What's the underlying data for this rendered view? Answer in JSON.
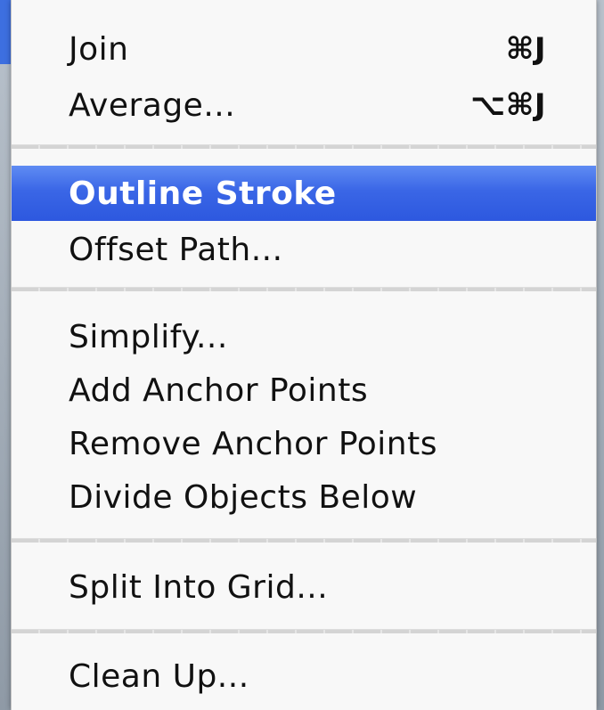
{
  "menu": {
    "groups": [
      [
        {
          "label": "Join",
          "shortcut": "⌘J"
        },
        {
          "label": "Average...",
          "shortcut": "⌥⌘J"
        }
      ],
      [
        {
          "label": "Outline Stroke",
          "shortcut": "",
          "selected": true
        },
        {
          "label": "Offset Path...",
          "shortcut": ""
        }
      ],
      [
        {
          "label": "Simplify...",
          "shortcut": ""
        },
        {
          "label": "Add Anchor Points",
          "shortcut": ""
        },
        {
          "label": "Remove Anchor Points",
          "shortcut": ""
        },
        {
          "label": "Divide Objects Below",
          "shortcut": ""
        }
      ],
      [
        {
          "label": "Split Into Grid...",
          "shortcut": ""
        }
      ],
      [
        {
          "label": "Clean Up...",
          "shortcut": ""
        }
      ]
    ],
    "colors": {
      "selection": "#3a66e6",
      "background": "#f8f8f8",
      "separator": "#d4d4d4"
    }
  }
}
